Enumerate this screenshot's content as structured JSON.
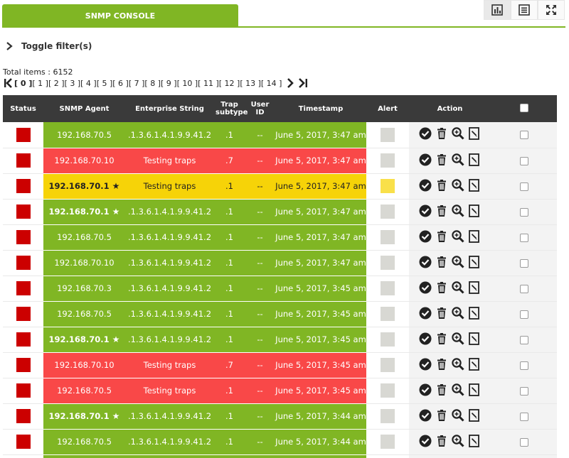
{
  "tab": {
    "label": "SNMP CONSOLE"
  },
  "toolbar": {
    "icons": [
      "bar-chart-icon",
      "list-view-icon",
      "fullscreen-icon"
    ]
  },
  "filter": {
    "label": "Toggle filter(s)"
  },
  "summary": {
    "total_items": "Total items : 6152"
  },
  "pagination": {
    "pages": [
      "[ 0 ]",
      "[ 1 ]",
      "[ 2 ]",
      "[ 3 ]",
      "[ 4 ]",
      "[ 5 ]",
      "[ 6 ]",
      "[ 7 ]",
      "[ 8 ]",
      "[ 9 ]",
      "[ 10 ]",
      "[ 11 ]",
      "[ 12 ]",
      "[ 13 ]",
      "[ 14 ]"
    ],
    "current": 0
  },
  "table": {
    "headers": {
      "status": "Status",
      "agent": "SNMP Agent",
      "enterprise": "Enterprise String",
      "trap_subtype": "Trap subtype",
      "user_id": "User ID",
      "timestamp": "Timestamp",
      "alert": "Alert",
      "action": "Action"
    },
    "colors": {
      "green": "#80b624",
      "red": "#f94848",
      "yellow": "#f6d308",
      "status": "#cc0000"
    },
    "rows": [
      {
        "color": "green",
        "agent": "192.168.70.5",
        "bold": false,
        "star": false,
        "enterprise": ".1.3.6.1.4.1.9.9.41.2",
        "subtype": ".1",
        "user": "--",
        "timestamp": "June 5, 2017, 3:47 am",
        "alert": false
      },
      {
        "color": "red",
        "agent": "192.168.70.10",
        "bold": false,
        "star": false,
        "enterprise": "Testing traps",
        "subtype": ".7",
        "user": "--",
        "timestamp": "June 5, 2017, 3:47 am",
        "alert": false
      },
      {
        "color": "yellow",
        "agent": "192.168.70.1",
        "bold": true,
        "star": true,
        "enterprise": "Testing traps",
        "subtype": ".1",
        "user": "--",
        "timestamp": "June 5, 2017, 3:47 am",
        "alert": true
      },
      {
        "color": "green",
        "agent": "192.168.70.1",
        "bold": true,
        "star": true,
        "enterprise": ".1.3.6.1.4.1.9.9.41.2",
        "subtype": ".1",
        "user": "--",
        "timestamp": "June 5, 2017, 3:47 am",
        "alert": false
      },
      {
        "color": "green",
        "agent": "192.168.70.5",
        "bold": false,
        "star": false,
        "enterprise": ".1.3.6.1.4.1.9.9.41.2",
        "subtype": ".1",
        "user": "--",
        "timestamp": "June 5, 2017, 3:47 am",
        "alert": false
      },
      {
        "color": "green",
        "agent": "192.168.70.10",
        "bold": false,
        "star": false,
        "enterprise": ".1.3.6.1.4.1.9.9.41.2",
        "subtype": ".1",
        "user": "--",
        "timestamp": "June 5, 2017, 3:47 am",
        "alert": false
      },
      {
        "color": "green",
        "agent": "192.168.70.3",
        "bold": false,
        "star": false,
        "enterprise": ".1.3.6.1.4.1.9.9.41.2",
        "subtype": ".1",
        "user": "--",
        "timestamp": "June 5, 2017, 3:45 am",
        "alert": false
      },
      {
        "color": "green",
        "agent": "192.168.70.5",
        "bold": false,
        "star": false,
        "enterprise": ".1.3.6.1.4.1.9.9.41.2",
        "subtype": ".1",
        "user": "--",
        "timestamp": "June 5, 2017, 3:45 am",
        "alert": false
      },
      {
        "color": "green",
        "agent": "192.168.70.1",
        "bold": true,
        "star": true,
        "enterprise": ".1.3.6.1.4.1.9.9.41.2",
        "subtype": ".1",
        "user": "--",
        "timestamp": "June 5, 2017, 3:45 am",
        "alert": false
      },
      {
        "color": "red",
        "agent": "192.168.70.10",
        "bold": false,
        "star": false,
        "enterprise": "Testing traps",
        "subtype": ".7",
        "user": "--",
        "timestamp": "June 5, 2017, 3:45 am",
        "alert": false
      },
      {
        "color": "red",
        "agent": "192.168.70.5",
        "bold": false,
        "star": false,
        "enterprise": "Testing traps",
        "subtype": ".1",
        "user": "--",
        "timestamp": "June 5, 2017, 3:45 am",
        "alert": false
      },
      {
        "color": "green",
        "agent": "192.168.70.1",
        "bold": true,
        "star": true,
        "enterprise": ".1.3.6.1.4.1.9.9.41.2",
        "subtype": ".1",
        "user": "--",
        "timestamp": "June 5, 2017, 3:44 am",
        "alert": false
      },
      {
        "color": "green",
        "agent": "192.168.70.5",
        "bold": false,
        "star": false,
        "enterprise": ".1.3.6.1.4.1.9.9.41.2",
        "subtype": ".1",
        "user": "--",
        "timestamp": "June 5, 2017, 3:44 am",
        "alert": false
      },
      {
        "color": "green",
        "agent": "",
        "bold": false,
        "star": false,
        "enterprise": "",
        "subtype": "",
        "user": "",
        "timestamp": "",
        "alert": false
      }
    ]
  }
}
